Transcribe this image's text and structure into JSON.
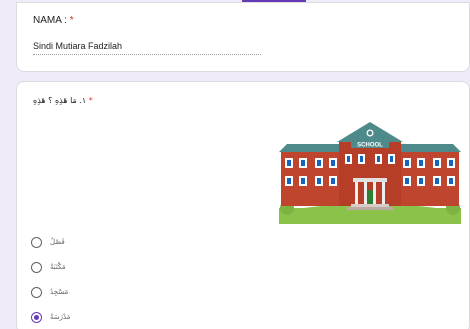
{
  "form": {
    "name_field": {
      "label": "NAMA : ",
      "required_mark": "*",
      "value": "Sindi Mutiara Fadzilah"
    },
    "question": {
      "text": "١. مَا هَذِهِ ؟ هَذِهِ",
      "required_mark": "*",
      "image_sign": "SCHOOL",
      "options": [
        {
          "label": "فَصْلٌ",
          "checked": false
        },
        {
          "label": "مَكْتَبَةٌ",
          "checked": false
        },
        {
          "label": "مَسْجِدٌ",
          "checked": false
        },
        {
          "label": "مَدْرَسَةٌ",
          "checked": true
        }
      ]
    }
  },
  "colors": {
    "accent": "#673ab7",
    "background": "#f0ebf8",
    "required": "#d93025",
    "building": "#c0452e",
    "roof": "#4f8a8b",
    "grass": "#8bc34a"
  }
}
